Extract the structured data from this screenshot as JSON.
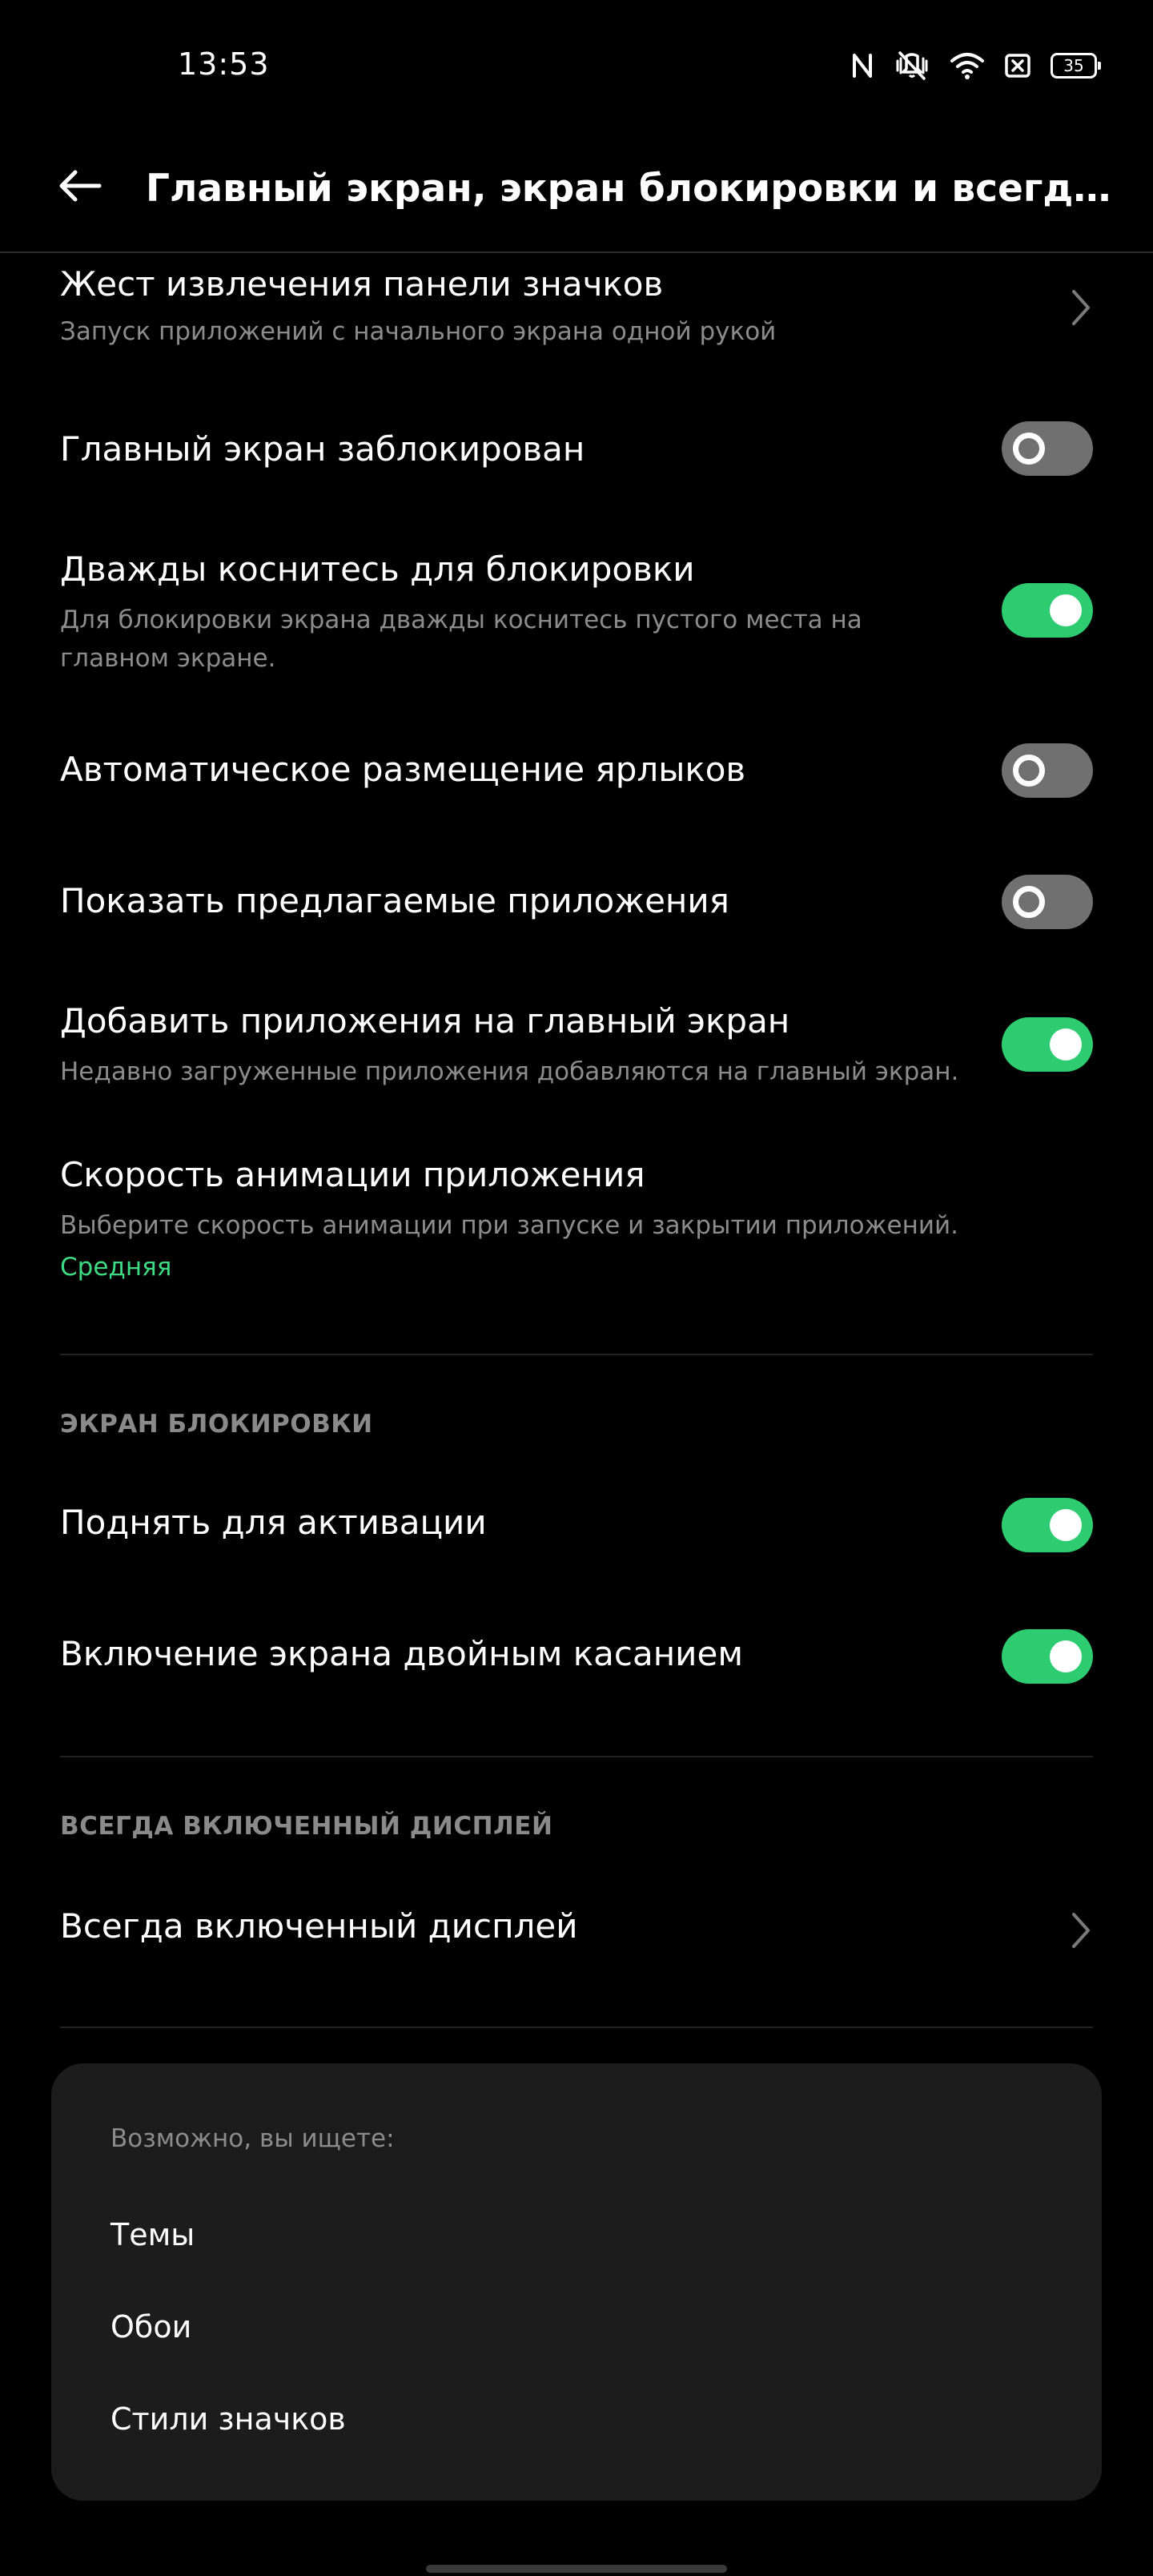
{
  "status_bar": {
    "time": "13:53",
    "battery": "35",
    "icons": [
      "nfc-icon",
      "mute-vibrate-icon",
      "wifi-icon",
      "sim-off-icon",
      "battery-icon"
    ]
  },
  "header": {
    "title": "Главный экран, экран блокировки и всегда включенный дисплей",
    "back_icon": "arrow-left-icon"
  },
  "home_settings": [
    {
      "title": "Жест извлечения панели значков",
      "subtitle": "Запуск приложений с начального экрана одной рукой",
      "control": "chevron"
    },
    {
      "title": "Главный экран заблокирован",
      "control": "toggle",
      "on": false
    },
    {
      "title": "Дважды коснитесь для блокировки",
      "subtitle": "Для блокировки экрана дважды коснитесь пустого места на главном экране.",
      "control": "toggle",
      "on": true
    },
    {
      "title": "Автоматическое размещение ярлыков",
      "control": "toggle",
      "on": false
    },
    {
      "title": "Показать предлагаемые приложения",
      "control": "toggle",
      "on": false
    },
    {
      "title": "Добавить приложения на главный экран",
      "subtitle": "Недавно загруженные приложения добавляются на главный экран.",
      "control": "toggle",
      "on": true
    },
    {
      "title": "Скорость анимации приложения",
      "subtitle": "Выберите скорость анимации при запуске и закрытии приложений.",
      "value": "Средняя",
      "control": "none"
    }
  ],
  "lock_screen": {
    "header": "ЭКРАН БЛОКИРОВКИ",
    "items": [
      {
        "title": "Поднять для активации",
        "control": "toggle",
        "on": true
      },
      {
        "title": "Включение экрана двойным касанием",
        "control": "toggle",
        "on": true
      }
    ]
  },
  "aod": {
    "header": "ВСЕГДА ВКЛЮЧЕННЫЙ ДИСПЛЕЙ",
    "items": [
      {
        "title": "Всегда включенный дисплей",
        "control": "chevron"
      }
    ]
  },
  "suggestions": {
    "heading": "Возможно, вы ищете:",
    "items": [
      "Темы",
      "Обои",
      "Стили значков"
    ]
  },
  "colors": {
    "background": "#000000",
    "accent": "#2ecc71",
    "toggle_off": "#707070",
    "secondary_text": "#8c8c8c",
    "value_text": "#3ddc84",
    "card": "#1c1c1c"
  }
}
